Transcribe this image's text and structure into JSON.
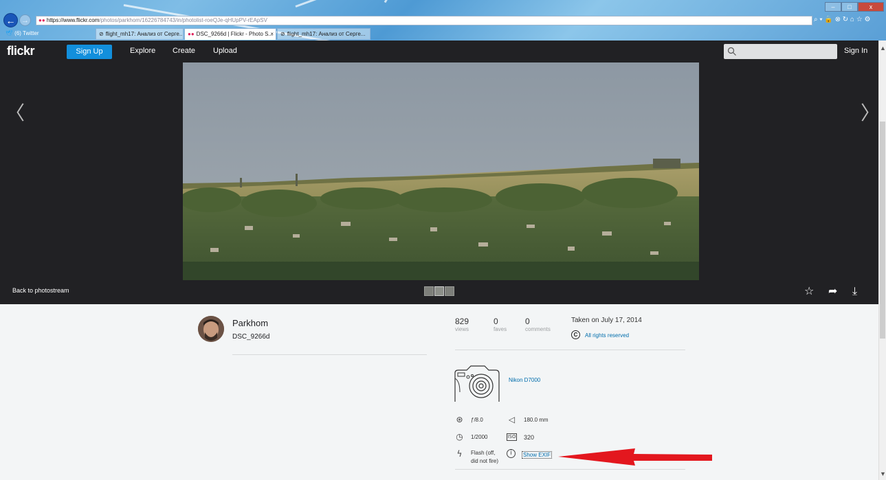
{
  "browser": {
    "address": {
      "https": "https://",
      "host": "www.flickr.com",
      "path": "/photos/parkhom/16226784743/in/photolist-roeQJe-qHUpPV-rEApSV"
    },
    "tabs": [
      {
        "label": "(6) Twitter",
        "icon": "twitter-icon"
      },
      {
        "label": "flight_mh17: Анализ от Серге...",
        "icon": "link-icon"
      },
      {
        "label": "DSC_9266d | Flickr - Photo S...",
        "icon": "flickr-icon"
      },
      {
        "label": "flight_mh17: Анализ от Серге...",
        "icon": "link-icon"
      }
    ],
    "tab_close": "×",
    "tool_icons": "⌕ ▾ 🔒 ⊗ ↻   ⌂ ☆ ⚙",
    "window_buttons": [
      "–",
      "□",
      "x"
    ]
  },
  "flickr": {
    "logo": "flickr",
    "signup": "Sign Up",
    "nav": [
      "Explore",
      "Create",
      "Upload"
    ],
    "signin": "Sign In"
  },
  "stage": {
    "prev": "〈",
    "next": "〉",
    "back_label": "Back to photostream",
    "actions": [
      "☆",
      "➦",
      "⤓"
    ]
  },
  "photo_info": {
    "owner": "Parkhom",
    "title": "DSC_9266d",
    "stats": [
      {
        "value": "829",
        "label": "views"
      },
      {
        "value": "0",
        "label": "faves"
      },
      {
        "value": "0",
        "label": "comments"
      }
    ],
    "taken": "Taken on July 17, 2014",
    "copyright_symbol": "C",
    "rights": "All rights reserved",
    "camera": "Nikon D7000",
    "exif": {
      "aperture": "ƒ/8.0",
      "focal_length": "180.0 mm",
      "exposure": "1/2000",
      "iso": "320",
      "iso_label": "ISO",
      "flash_line1": "Flash (off,",
      "flash_line2": "did not fire)",
      "show_exif": "Show EXIF"
    }
  },
  "colors": {
    "flickr_blue": "#128fdc",
    "link_blue": "#006dac",
    "nav_bg": "#212124",
    "annotation_red": "#e3171e"
  }
}
